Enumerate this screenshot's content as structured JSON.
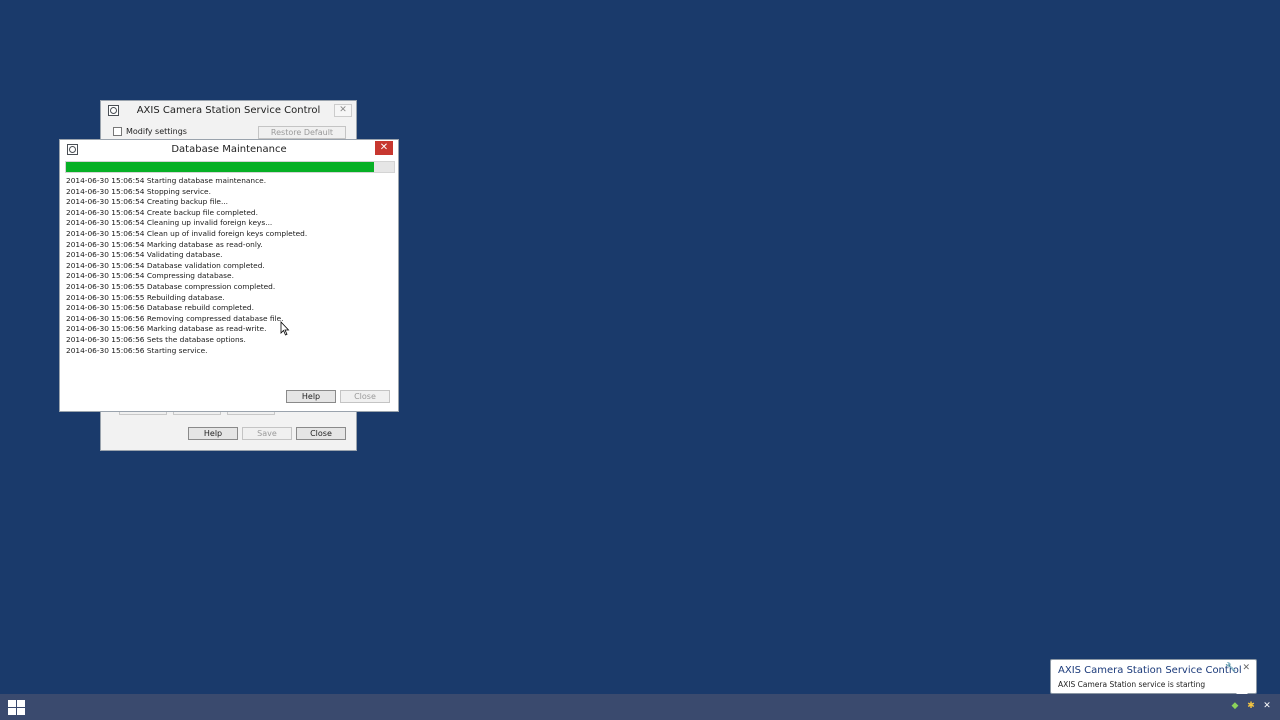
{
  "service_window": {
    "title": "AXIS Camera Station Service Control",
    "close_glyph": "✕",
    "modify_settings_label": "Modify settings",
    "restore_defaults_label": "Restore Default Settings",
    "help_label": "Help",
    "save_label": "Save",
    "close_label": "Close"
  },
  "db_window": {
    "title": "Database Maintenance",
    "close_glyph": "✕",
    "progress": 0.94,
    "log": [
      "2014-06-30 15:06:54 Starting database maintenance.",
      "2014-06-30 15:06:54 Stopping service.",
      "2014-06-30 15:06:54 Creating backup file...",
      "2014-06-30 15:06:54 Create backup file completed.",
      "2014-06-30 15:06:54 Cleaning up invalid foreign keys...",
      "2014-06-30 15:06:54 Clean up of invalid foreign keys completed.",
      "2014-06-30 15:06:54 Marking database as read-only.",
      "2014-06-30 15:06:54 Validating database.",
      "2014-06-30 15:06:54 Database validation completed.",
      "2014-06-30 15:06:54 Compressing database.",
      "2014-06-30 15:06:55 Database compression completed.",
      "2014-06-30 15:06:55 Rebuilding database.",
      "2014-06-30 15:06:56 Database rebuild completed.",
      "2014-06-30 15:06:56 Removing compressed database file.",
      "2014-06-30 15:06:56 Marking database as read-write.",
      "2014-06-30 15:06:56 Sets the database options.",
      "2014-06-30 15:06:56 Starting service."
    ],
    "help_label": "Help",
    "close_label": "Close"
  },
  "notification": {
    "title": "AXIS Camera Station Service Control",
    "message": "AXIS Camera Station service is starting",
    "icons": [
      "wrench-icon",
      "close-icon"
    ]
  },
  "taskbar": {
    "start_icon": "windows-logo-icon",
    "tray_icons": [
      "shield-icon",
      "camera-station-icon",
      "network-icon"
    ]
  },
  "colors": {
    "desktop": "#1a3a6b",
    "progress_fill": "#06b025",
    "close_red": "#c7372f",
    "taskbar": "#3a4a6e"
  }
}
